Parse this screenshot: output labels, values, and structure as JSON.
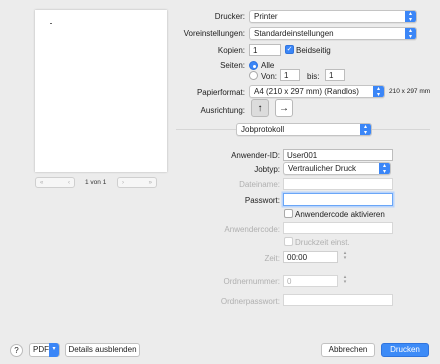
{
  "preview": {
    "page_of": "1 von 1",
    "first": "«",
    "prev": "‹",
    "next": "›",
    "last": "»"
  },
  "printer": {
    "label": "Drucker:",
    "value": "Printer"
  },
  "presets": {
    "label": "Voreinstellungen:",
    "value": "Standardeinstellungen"
  },
  "copies": {
    "label": "Kopien:",
    "value": "1",
    "duplex_label": "Beidseitig",
    "duplex_checked": true
  },
  "pages": {
    "label": "Seiten:",
    "all_label": "Alle",
    "from_label": "Von:",
    "from_value": "1",
    "to_label": "bis:",
    "to_value": "1"
  },
  "paper": {
    "label": "Papierformat:",
    "value": "A4 (210 x 297 mm) (Randlos)",
    "size_text": "210 x 297 mm"
  },
  "orientation": {
    "label": "Ausrichtung:"
  },
  "section": {
    "value": "Jobprotokoll"
  },
  "job": {
    "user_id_label": "Anwender-ID:",
    "user_id_value": "User001",
    "jobtype_label": "Jobtyp:",
    "jobtype_value": "Vertraulicher Druck",
    "filename_label": "Dateiname:",
    "filename_value": "",
    "password_label": "Passwort:",
    "password_value": "",
    "usercode_enable_label": "Anwendercode aktivieren",
    "usercode_label": "Anwendercode:",
    "usercode_value": "",
    "delayed_label": "Druckzeit einst.",
    "time_label": "Zeit:",
    "time_value": "00:00",
    "order_label": "Ordnernummer:",
    "order_value": "0",
    "order_pw_label": "Ordnerpasswort:",
    "order_pw_value": ""
  },
  "footer": {
    "help": "?",
    "pdf": "PDF",
    "hide_details": "Details ausblenden",
    "cancel": "Abbrechen",
    "print": "Drucken"
  },
  "colors": {
    "accent": "#3b86f7",
    "background": "#ececec"
  }
}
